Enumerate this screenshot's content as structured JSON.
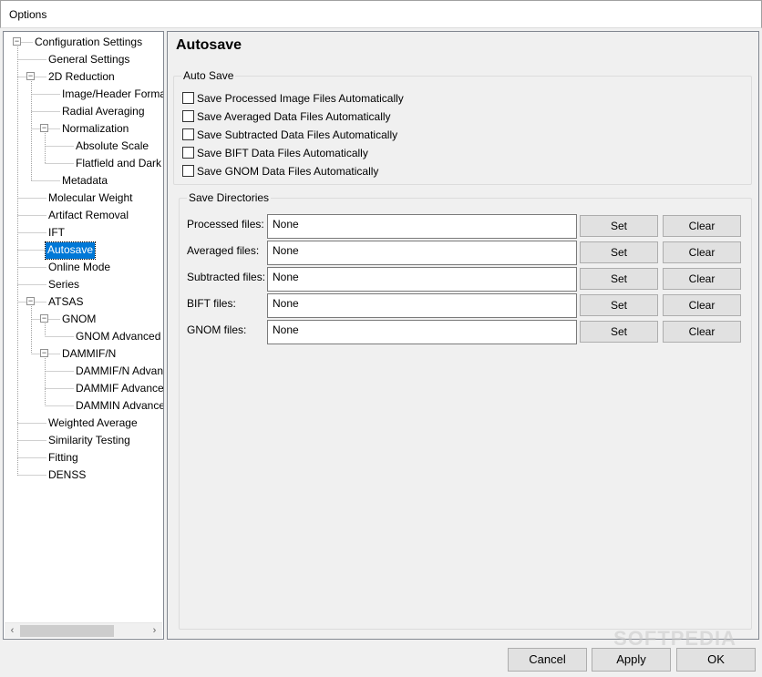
{
  "window": {
    "title": "Options"
  },
  "tree": {
    "items": [
      {
        "label": "Configuration Settings",
        "level": 0,
        "expanded": true
      },
      {
        "label": "General Settings",
        "level": 1
      },
      {
        "label": "2D Reduction",
        "level": 1,
        "expanded": true
      },
      {
        "label": "Image/Header Format",
        "level": 2
      },
      {
        "label": "Radial Averaging",
        "level": 2
      },
      {
        "label": "Normalization",
        "level": 2,
        "expanded": true
      },
      {
        "label": "Absolute Scale",
        "level": 3
      },
      {
        "label": "Flatfield and Dark",
        "level": 3
      },
      {
        "label": "Metadata",
        "level": 2
      },
      {
        "label": "Molecular Weight",
        "level": 1
      },
      {
        "label": "Artifact Removal",
        "level": 1
      },
      {
        "label": "IFT",
        "level": 1
      },
      {
        "label": "Autosave",
        "level": 1,
        "selected": true
      },
      {
        "label": "Online Mode",
        "level": 1
      },
      {
        "label": "Series",
        "level": 1
      },
      {
        "label": "ATSAS",
        "level": 1,
        "expanded": true
      },
      {
        "label": "GNOM",
        "level": 2,
        "expanded": true
      },
      {
        "label": "GNOM Advanced",
        "level": 3
      },
      {
        "label": "DAMMIF/N",
        "level": 2,
        "expanded": true
      },
      {
        "label": "DAMMIF/N Advanced",
        "level": 3
      },
      {
        "label": "DAMMIF Advanced",
        "level": 3
      },
      {
        "label": "DAMMIN Advanced",
        "level": 3
      },
      {
        "label": "Weighted Average",
        "level": 1
      },
      {
        "label": "Similarity Testing",
        "level": 1
      },
      {
        "label": "Fitting",
        "level": 1
      },
      {
        "label": "DENSS",
        "level": 1
      }
    ],
    "expander_symbol": "−",
    "scroll_left": "‹",
    "scroll_right": "›"
  },
  "page": {
    "title": "Autosave",
    "auto_save": {
      "label": "Auto Save",
      "options": [
        {
          "label": "Save Processed Image Files Automatically",
          "checked": false
        },
        {
          "label": "Save Averaged Data Files Automatically",
          "checked": false
        },
        {
          "label": "Save Subtracted Data Files Automatically",
          "checked": false
        },
        {
          "label": "Save BIFT Data Files Automatically",
          "checked": false
        },
        {
          "label": "Save GNOM Data Files Automatically",
          "checked": false
        }
      ]
    },
    "save_directories": {
      "label": "Save Directories",
      "rows": [
        {
          "label": "Processed files:",
          "value": "None",
          "set": "Set",
          "clear": "Clear"
        },
        {
          "label": "Averaged files:",
          "value": "None",
          "set": "Set",
          "clear": "Clear"
        },
        {
          "label": "Subtracted files:",
          "value": "None",
          "set": "Set",
          "clear": "Clear"
        },
        {
          "label": "BIFT files:",
          "value": "None",
          "set": "Set",
          "clear": "Clear"
        },
        {
          "label": "GNOM files:",
          "value": "None",
          "set": "Set",
          "clear": "Clear"
        }
      ]
    }
  },
  "footer": {
    "cancel": "Cancel",
    "apply": "Apply",
    "ok": "OK"
  },
  "watermark": "SOFTPEDIA",
  "colors": {
    "selection": "#0078d7",
    "button_face": "#e1e1e1",
    "panel_bg": "#f0f0f0"
  }
}
